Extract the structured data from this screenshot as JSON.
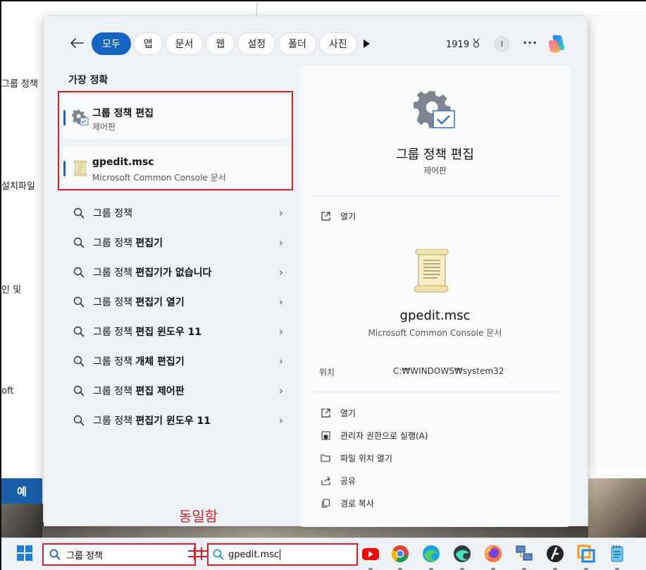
{
  "background": {
    "left_texts": [
      "그룹 정책",
      "설치파일",
      "인 및",
      "oft"
    ],
    "blue_button": "예"
  },
  "topbar": {
    "tabs": [
      "모두",
      "앱",
      "문서",
      "웹",
      "설정",
      "폴더",
      "사진"
    ],
    "points": "1919",
    "avatar": "I",
    "more": "···"
  },
  "results": {
    "best_header": "가장 정확",
    "best_items": [
      {
        "title": "그룹 정책 편집",
        "sub": "제어판",
        "icon": "gear-icon"
      },
      {
        "title": "gpedit.msc",
        "sub": "Microsoft Common Console 문서",
        "icon": "scroll-icon"
      }
    ],
    "suggestions": [
      {
        "prefix": "그룹 정책",
        "bold": ""
      },
      {
        "prefix": "그룹 정책 ",
        "bold": "편집기"
      },
      {
        "prefix": "그룹 정책 ",
        "bold": "편집기가 없습니다"
      },
      {
        "prefix": "그룹 정책 ",
        "bold": "편집기 열기"
      },
      {
        "prefix": "그룹 정책 ",
        "bold": "편집 윈도우 11"
      },
      {
        "prefix": "그룹 정책 ",
        "bold": "개체 편집기"
      },
      {
        "prefix": "그룹 정책 ",
        "bold": "편집 제어판"
      },
      {
        "prefix": "그룹 정책 ",
        "bold": "편집기 윈도우 11"
      }
    ]
  },
  "detail": {
    "title": "그룹 정책 편집",
    "sub": "제어판",
    "open_label": "열기",
    "title2": "gpedit.msc",
    "sub2": "Microsoft Common Console 문서",
    "location_label": "위치",
    "location_value": "C:₩WINDOWS₩system32",
    "actions": [
      "열기",
      "관리자 권한으로 실행(A)",
      "파일 위치 열기",
      "공유",
      "경로 복사"
    ]
  },
  "annotation": {
    "same_note": "동일함"
  },
  "taskbar": {
    "search1": "그룹 정책",
    "search2": "gpedit.msc",
    "apps": [
      "youtube-icon",
      "chrome-icon",
      "edge-icon",
      "edge-canary-icon",
      "firefox-icon",
      "network-icon",
      "opera-icon",
      "frame-icon",
      "notepad-icon"
    ]
  },
  "colors": {
    "accent": "#1565c0",
    "annotation_red": "#d61f2a"
  }
}
